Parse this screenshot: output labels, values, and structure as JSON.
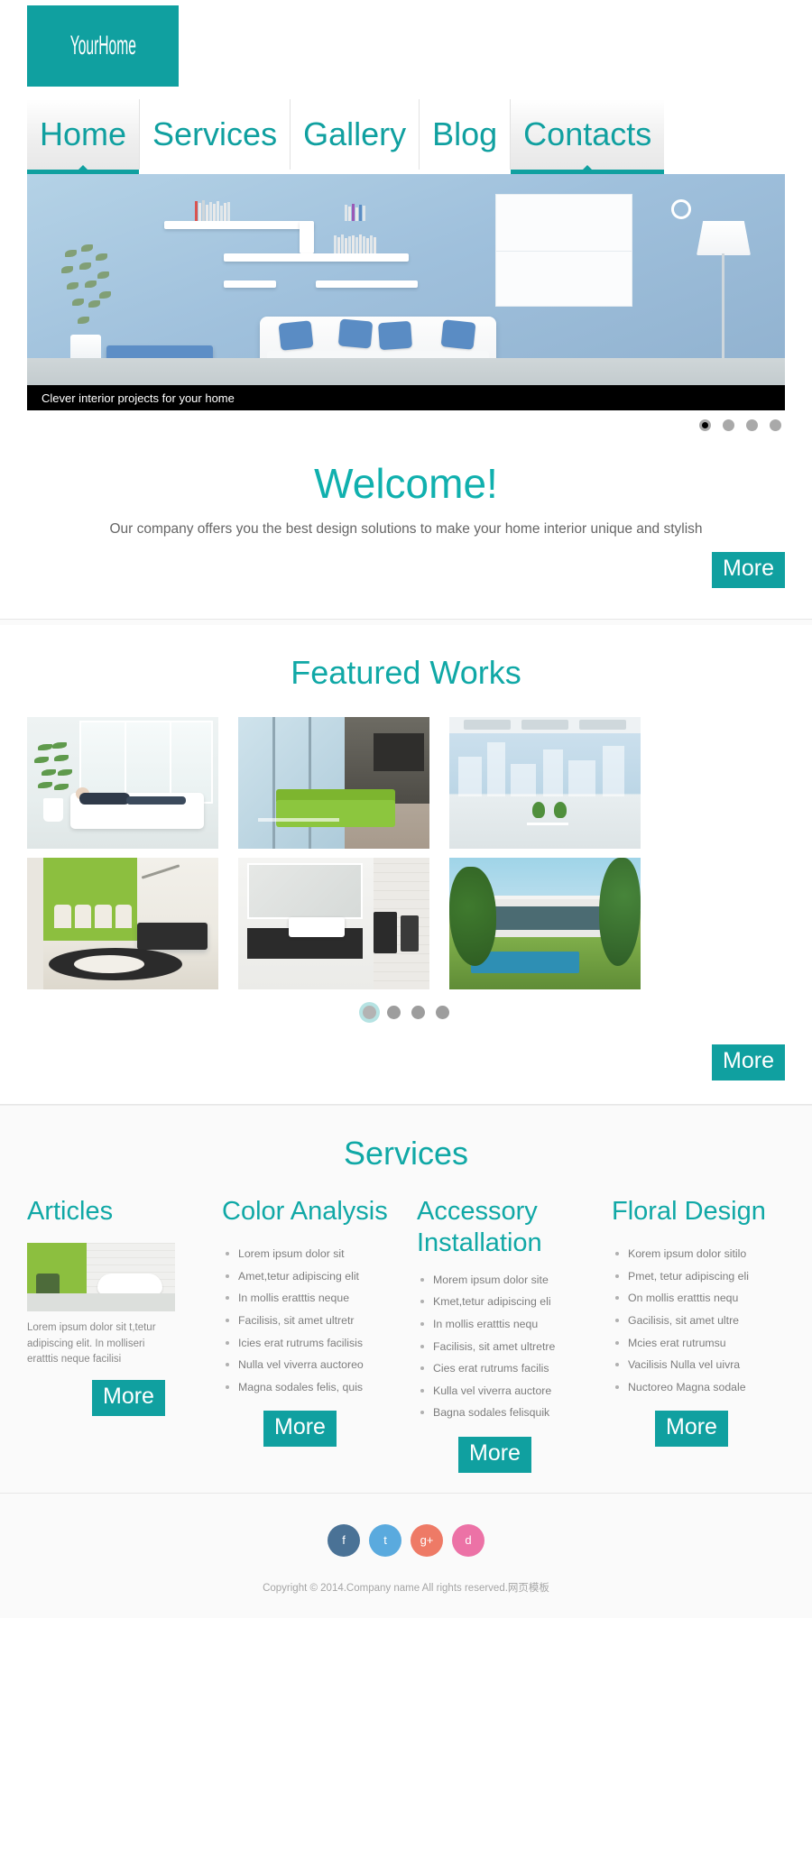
{
  "site": {
    "logo": "YourHome",
    "accent": "#10a0a0",
    "accent_light": "#10b0ae"
  },
  "nav": {
    "items": [
      {
        "label": "Home",
        "state": "active"
      },
      {
        "label": "Services",
        "state": "normal"
      },
      {
        "label": "Gallery",
        "state": "normal"
      },
      {
        "label": "Blog",
        "state": "normal"
      },
      {
        "label": "Contacts",
        "state": "highlight"
      }
    ]
  },
  "hero": {
    "caption": "Clever interior projects for your home",
    "dots": [
      {
        "active": true
      },
      {
        "active": false
      },
      {
        "active": false
      },
      {
        "active": false
      }
    ]
  },
  "welcome": {
    "title": "Welcome!",
    "subtitle": "Our company offers you the best design solutions to make your home interior unique and stylish",
    "more_label": "More"
  },
  "featured": {
    "title": "Featured Works",
    "tiles": [
      {
        "name": "white-living-room"
      },
      {
        "name": "green-sofa-modern-interior"
      },
      {
        "name": "office-with-city-view"
      },
      {
        "name": "green-wall-living-room"
      },
      {
        "name": "modern-bathroom"
      },
      {
        "name": "modern-house-exterior-pool"
      }
    ],
    "dots": [
      {
        "active": true
      },
      {
        "active": false
      },
      {
        "active": false
      },
      {
        "active": false
      }
    ],
    "more_label": "More"
  },
  "services": {
    "title": "Services",
    "columns": [
      {
        "heading": "Articles",
        "type": "article",
        "text": "Lorem ipsum dolor sit t,tetur adipiscing elit. In molliseri eratttis neque facilisi",
        "more_label": "More"
      },
      {
        "heading": "Color Analysis",
        "type": "list",
        "items": [
          "Lorem ipsum dolor sit",
          "Amet,tetur adipiscing elit",
          "In mollis eratttis neque",
          "Facilisis, sit amet ultretr",
          "Icies erat rutrums facilisis",
          "Nulla vel viverra auctoreo",
          "Magna sodales felis, quis"
        ],
        "more_label": "More"
      },
      {
        "heading": "Accessory Installation",
        "type": "list",
        "items": [
          "Morem ipsum dolor site",
          "Kmet,tetur adipiscing eli",
          "In mollis eratttis nequ",
          "Facilisis, sit amet ultretre",
          "Cies erat rutrums facilis",
          "Kulla vel viverra auctore",
          "Bagna sodales felisquik"
        ],
        "more_label": "More"
      },
      {
        "heading": "Floral Design",
        "type": "list",
        "items": [
          "Korem ipsum dolor sitilo",
          "Pmet, tetur adipiscing eli",
          "On mollis eratttis nequ",
          "Gacilisis, sit amet ultre",
          "Mcies erat rutrumsu",
          "Vacilisis Nulla vel uivra",
          "Nuctoreo Magna sodale"
        ],
        "more_label": "More"
      }
    ]
  },
  "footer": {
    "socials": [
      {
        "label": "f",
        "icon": "facebook-icon",
        "color": "#4a7296"
      },
      {
        "label": "t",
        "icon": "twitter-icon",
        "color": "#5aaade"
      },
      {
        "label": "g+",
        "icon": "googleplus-icon",
        "color": "#ee7a66"
      },
      {
        "label": "d",
        "icon": "dribbble-icon",
        "color": "#ec72a6"
      }
    ],
    "copyright": "Copyright © 2014.Company name All rights reserved.网页模板"
  }
}
